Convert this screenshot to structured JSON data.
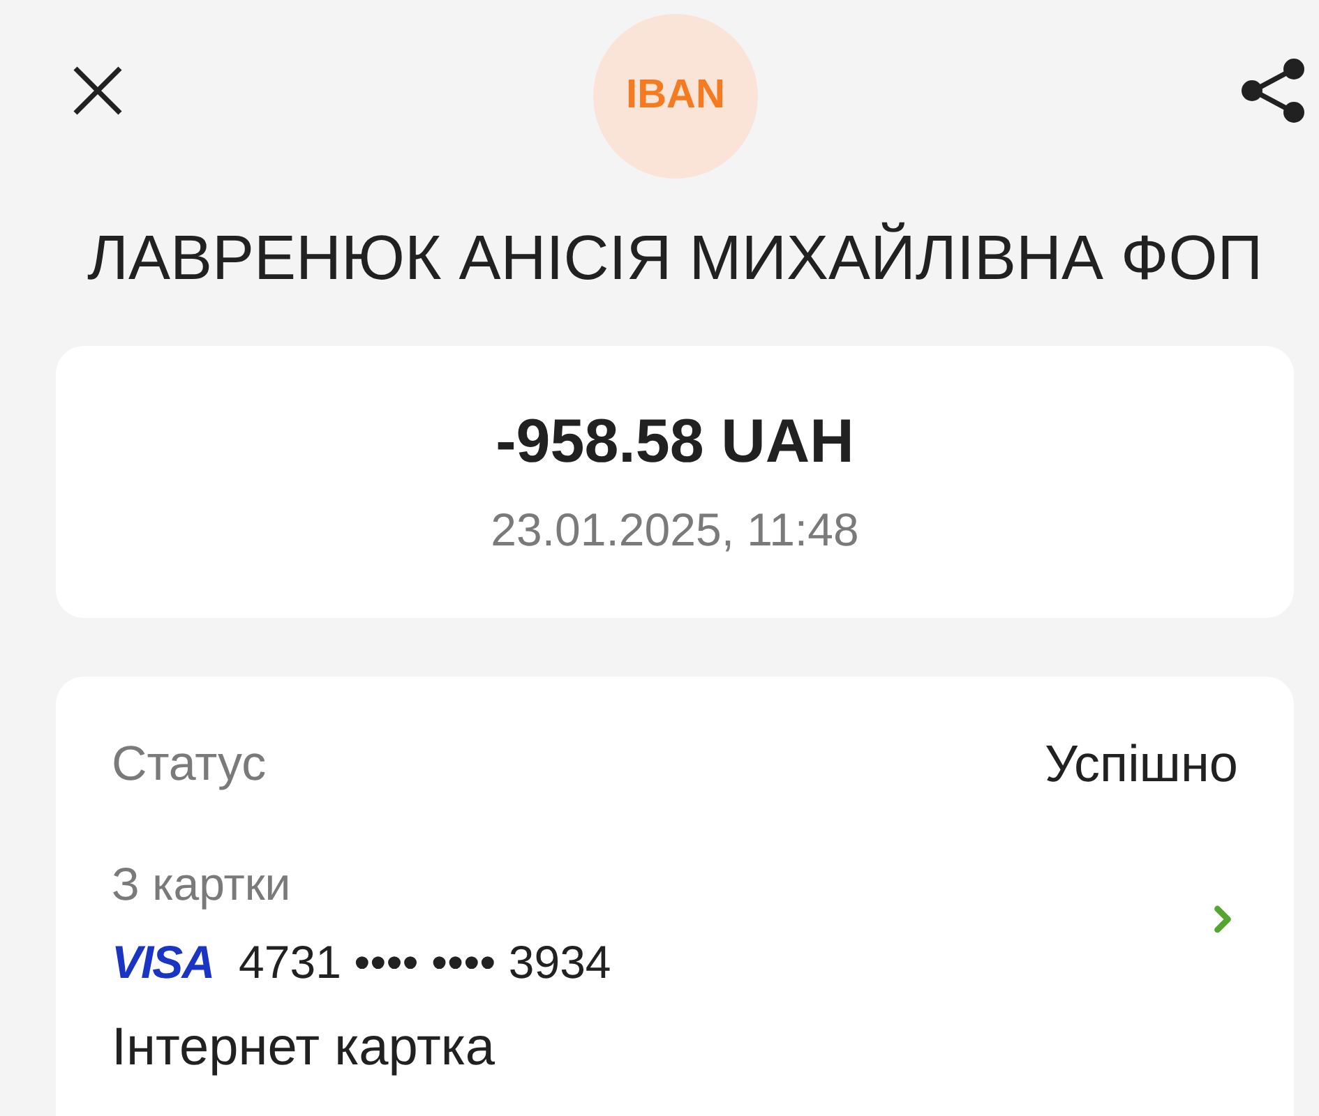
{
  "header": {
    "badge": "IBAN"
  },
  "recipient": "ЛАВРЕНЮК АНІСІЯ МИХАЙЛІВНА ФОП",
  "summary": {
    "amount": "-958.58 UAH",
    "datetime": "23.01.2025, 11:48"
  },
  "details": [
    {
      "kind": "pair",
      "label": "Статус",
      "value": "Успішно"
    },
    {
      "kind": "card",
      "label": "З картки",
      "brand": "VISA",
      "number": "4731 •••• •••• 3934",
      "card_name": "Інтернет картка"
    }
  ]
}
